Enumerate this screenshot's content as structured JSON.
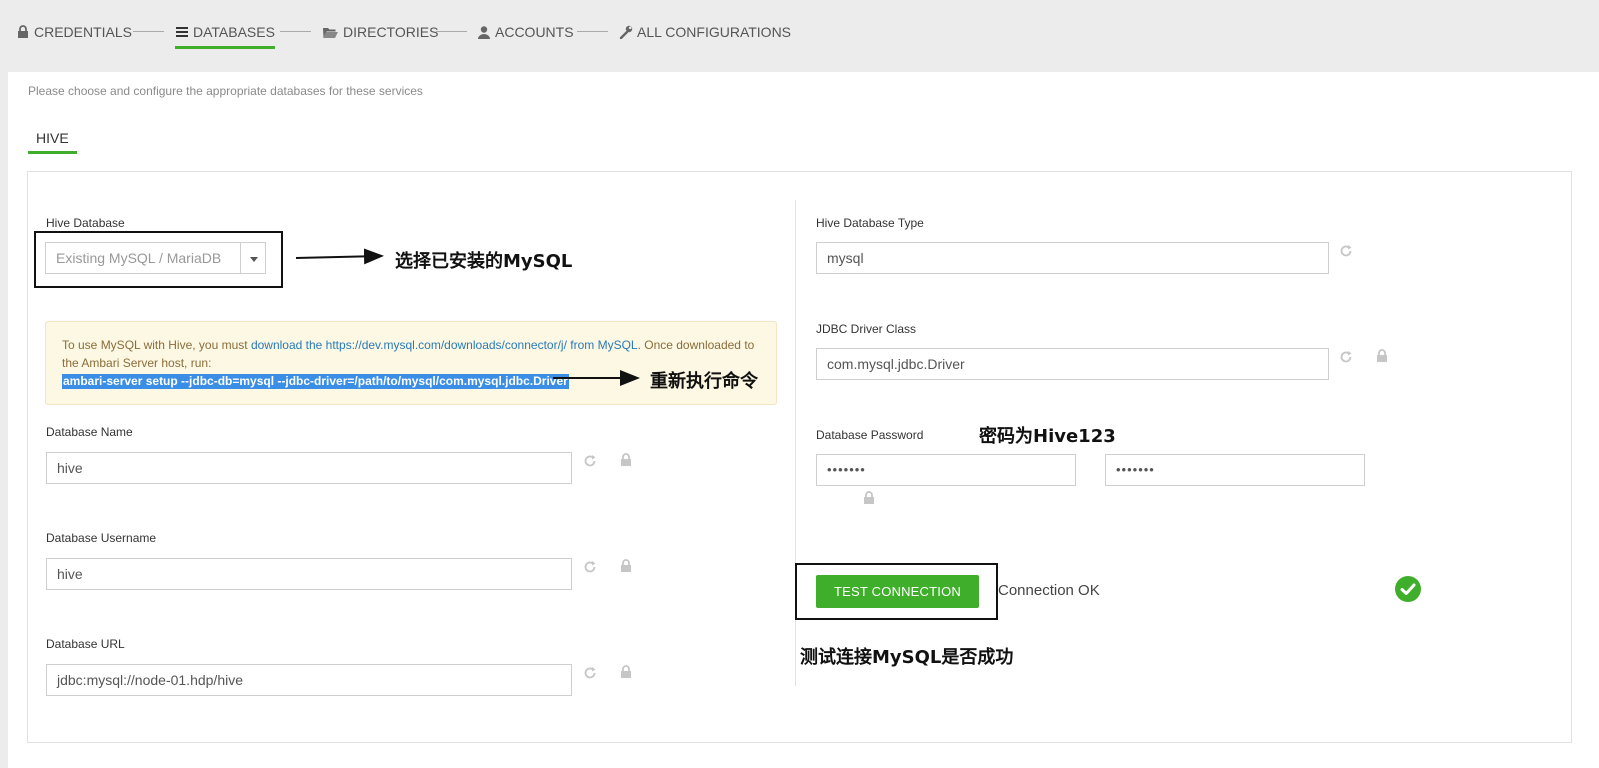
{
  "steps": [
    {
      "label": "CREDENTIALS",
      "icon": "lock-icon"
    },
    {
      "label": "DATABASES",
      "icon": "database-list-icon"
    },
    {
      "label": "DIRECTORIES",
      "icon": "folder-open-icon"
    },
    {
      "label": "ACCOUNTS",
      "icon": "user-icon"
    },
    {
      "label": "ALL CONFIGURATIONS",
      "icon": "wrench-icon"
    }
  ],
  "active_step": "DATABASES",
  "intro": "Please choose and configure the appropriate databases for these services",
  "service_tab": "HIVE",
  "left": {
    "hive_database": {
      "label": "Hive Database",
      "value": "Existing MySQL / MariaDB"
    },
    "warning": {
      "prefix": "To use MySQL with Hive, you must ",
      "link": "download the https://dev.mysql.com/downloads/connector/j/ from MySQL",
      "suffix": ". Once downloaded to the Ambari Server host, run:",
      "command": "ambari-server setup --jdbc-db=mysql --jdbc-driver=/path/to/mysql/com.mysql.jdbc.Driver"
    },
    "db_name": {
      "label": "Database Name",
      "value": "hive"
    },
    "db_user": {
      "label": "Database Username",
      "value": "hive"
    },
    "db_url": {
      "label": "Database URL",
      "value": "jdbc:mysql://node-01.hdp/hive"
    }
  },
  "right": {
    "db_type": {
      "label": "Hive Database Type",
      "value": "mysql"
    },
    "jdbc_driver": {
      "label": "JDBC Driver Class",
      "value": "com.mysql.jdbc.Driver"
    },
    "db_password": {
      "label": "Database Password",
      "value": "•••••••",
      "confirm": "•••••••"
    },
    "test_button": "TEST CONNECTION",
    "connection_status": "Connection OK"
  },
  "annotations": {
    "select_mysql": "选择已安装的MySQL",
    "rerun_command": "重新执行命令",
    "password_note": "密码为Hive123",
    "test_note": "测试连接MySQL是否成功"
  },
  "colors": {
    "accent_green": "#3fae2a",
    "link_blue": "#2a7ab8",
    "warning_bg": "#fcf8e3",
    "selection_blue": "#3a8ee6"
  }
}
